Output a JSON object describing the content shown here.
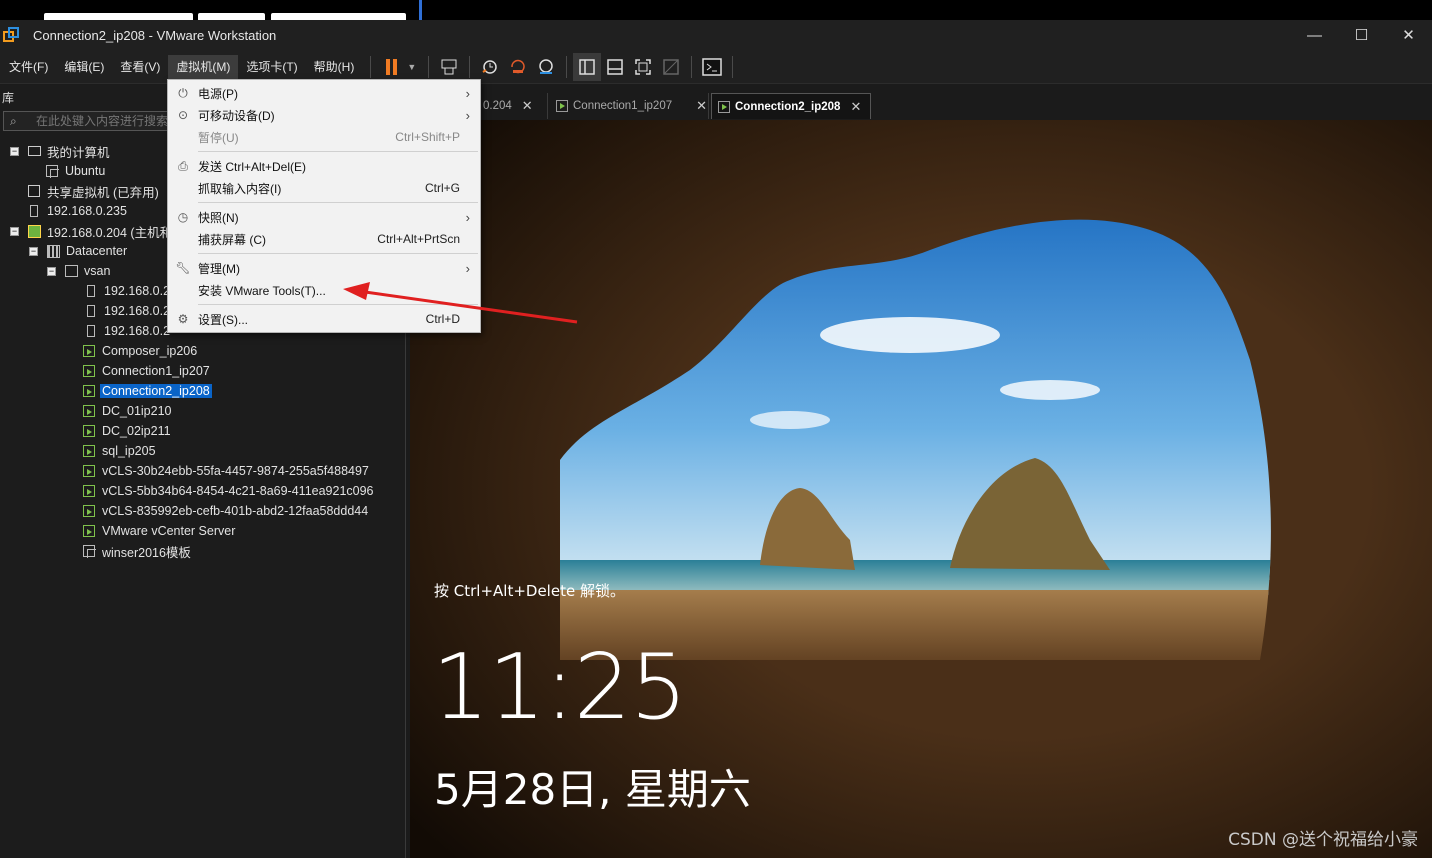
{
  "window": {
    "title": "Connection2_ip208 - VMware Workstation",
    "controls": {
      "minimize": "—",
      "maximize": "☐",
      "close": "✕"
    }
  },
  "menubar": {
    "items": [
      "文件(F)",
      "编辑(E)",
      "查看(V)",
      "虚拟机(M)",
      "选项卡(T)",
      "帮助(H)"
    ],
    "active_index": 3
  },
  "library": {
    "title": "库",
    "search_placeholder": "在此处键入内容进行搜索",
    "tree": [
      {
        "label": "我的计算机",
        "icon": "computer-icon"
      },
      {
        "label": "Ubuntu",
        "icon": "vm-icon"
      },
      {
        "label": "共享虚拟机 (已弃用)",
        "icon": "shared-vm-icon"
      },
      {
        "label": "192.168.0.235",
        "icon": "host-icon"
      },
      {
        "label": "192.168.0.204 (主机和",
        "icon": "vcenter-icon"
      },
      {
        "label": "Datacenter",
        "icon": "datacenter-icon"
      },
      {
        "label": "vsan",
        "icon": "cluster-icon"
      },
      {
        "label": "192.168.0.2",
        "icon": "host-icon"
      },
      {
        "label": "192.168.0.2",
        "icon": "host-icon"
      },
      {
        "label": "192.168.0.2",
        "icon": "host-icon"
      },
      {
        "label": "Composer_ip206",
        "icon": "vm-running-icon"
      },
      {
        "label": "Connection1_ip207",
        "icon": "vm-running-icon"
      },
      {
        "label": "Connection2_ip208",
        "icon": "vm-running-icon",
        "selected": true
      },
      {
        "label": "DC_01ip210",
        "icon": "vm-running-icon"
      },
      {
        "label": "DC_02ip211",
        "icon": "vm-running-icon"
      },
      {
        "label": "sql_ip205",
        "icon": "vm-running-icon"
      },
      {
        "label": "vCLS-30b24ebb-55fa-4457-9874-255a5f488497",
        "icon": "vm-running-icon"
      },
      {
        "label": "vCLS-5bb34b64-8454-4c21-8a69-411ea921c096",
        "icon": "vm-running-icon"
      },
      {
        "label": "vCLS-835992eb-cefb-401b-abd2-12faa58ddd44",
        "icon": "vm-running-icon"
      },
      {
        "label": "VMware vCenter Server",
        "icon": "vm-running-icon"
      },
      {
        "label": "winser2016模板",
        "icon": "vm-icon"
      }
    ]
  },
  "tabs": [
    {
      "label": "0.204"
    },
    {
      "label": "Connection1_ip207"
    },
    {
      "label": "Connection2_ip208",
      "active": true
    }
  ],
  "vm_menu": {
    "items": [
      {
        "label": "电源(P)",
        "shortcut": "",
        "submenu": true,
        "icon": "power-icon"
      },
      {
        "label": "可移动设备(D)",
        "shortcut": "",
        "submenu": true,
        "icon": "removable-devices-icon"
      },
      {
        "label": "暂停(U)",
        "shortcut": "Ctrl+Shift+P",
        "disabled": true,
        "icon": ""
      },
      {
        "label": "发送 Ctrl+Alt+Del(E)",
        "shortcut": "",
        "icon": "send-keys-icon"
      },
      {
        "label": "抓取输入内容(I)",
        "shortcut": "Ctrl+G",
        "icon": ""
      },
      {
        "label": "快照(N)",
        "shortcut": "",
        "submenu": true,
        "icon": "snapshot-icon"
      },
      {
        "label": "捕获屏幕 (C)",
        "shortcut": "Ctrl+Alt+PrtScn",
        "icon": ""
      },
      {
        "label": "管理(M)",
        "shortcut": "",
        "submenu": true,
        "icon": "wrench-icon"
      },
      {
        "label": "安装 VMware Tools(T)...",
        "shortcut": "",
        "icon": ""
      },
      {
        "label": "设置(S)...",
        "shortcut": "Ctrl+D",
        "icon": "settings-icon"
      }
    ]
  },
  "guest": {
    "unlock_hint": "按 Ctrl+Alt+Delete 解锁。",
    "time": "11:25",
    "date": "5月28日, 星期六"
  },
  "watermark": "CSDN @送个祝福给小豪",
  "colors": {
    "accent_orange": "#f07b23",
    "selection_blue": "#0a64c8",
    "annotation_red": "#e02020"
  }
}
